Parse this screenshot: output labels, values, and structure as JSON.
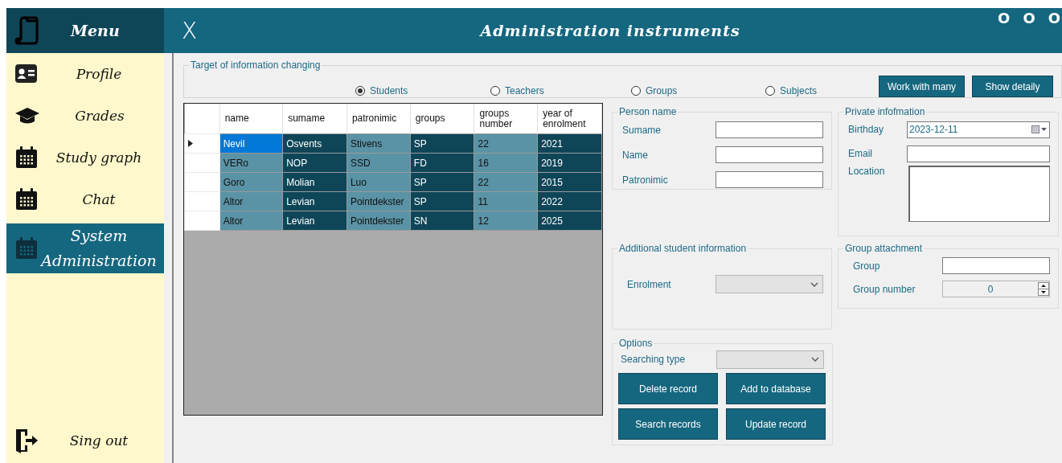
{
  "sidebar": {
    "title": "Menu",
    "items": [
      {
        "label": "Profile",
        "kind": "card",
        "selected": false
      },
      {
        "label": "Grades",
        "kind": "cap",
        "selected": false
      },
      {
        "label": "Study graph",
        "kind": "calendar",
        "selected": false
      },
      {
        "label": "Chat",
        "kind": "calendar",
        "selected": false
      },
      {
        "label": "System Administration",
        "kind": "calendar",
        "selected": true
      }
    ],
    "sign_out": {
      "label": "Sing out"
    }
  },
  "header": {
    "close": "X",
    "title": "Administration instruments",
    "window_controls": [
      "O",
      "O",
      "O"
    ]
  },
  "target": {
    "legend": "Target of information changing",
    "options": [
      {
        "label": "Students",
        "selected": true
      },
      {
        "label": "Teachers",
        "selected": false
      },
      {
        "label": "Groups",
        "selected": false
      },
      {
        "label": "Subjects",
        "selected": false
      }
    ],
    "buttons": [
      "Work with many",
      "Show detaily"
    ]
  },
  "table": {
    "columns": [
      "name",
      "sumame",
      "patronimic",
      "groups",
      "groups number",
      "year of enrolment"
    ],
    "rows": [
      {
        "selected": true,
        "cells": [
          "Nevil",
          "Osvents",
          "Stivens",
          "SP",
          "22",
          "2021"
        ]
      },
      {
        "selected": false,
        "cells": [
          "VERo",
          "NOP",
          "SSD",
          "FD",
          "16",
          "2019"
        ]
      },
      {
        "selected": false,
        "cells": [
          "Goro",
          "Molian",
          "Luo",
          "SP",
          "22",
          "2015"
        ]
      },
      {
        "selected": false,
        "cells": [
          "Altor",
          "Levian",
          "Pointdekster",
          "SP",
          "11",
          "2022"
        ]
      },
      {
        "selected": false,
        "cells": [
          "Altor",
          "Levian",
          "Pointdekster",
          "SN",
          "12",
          "2025"
        ]
      }
    ]
  },
  "person_name": {
    "legend": "Person name",
    "fields": [
      {
        "label": "Sumame"
      },
      {
        "label": "Name"
      },
      {
        "label": "Patronimic"
      }
    ]
  },
  "private_info": {
    "legend": "Private infofmation",
    "fields": [
      {
        "label": "Birthday",
        "kind": "date",
        "value": "2023-12-11"
      },
      {
        "label": "Email",
        "kind": "text"
      },
      {
        "label": "Location",
        "kind": "textarea"
      }
    ]
  },
  "additional": {
    "legend": "Additional student information",
    "fields": [
      {
        "label": "Enrolment",
        "kind": "dropdown"
      }
    ]
  },
  "group_attachment": {
    "legend": "Group attachment",
    "fields": [
      {
        "label": "Group",
        "kind": "text"
      },
      {
        "label": "Group number",
        "kind": "spinner",
        "value": "0"
      }
    ]
  },
  "options": {
    "legend": "Options",
    "search_label": "Searching type",
    "buttons": [
      "Delete record",
      "Add to database",
      "Search records",
      "Update record"
    ]
  }
}
